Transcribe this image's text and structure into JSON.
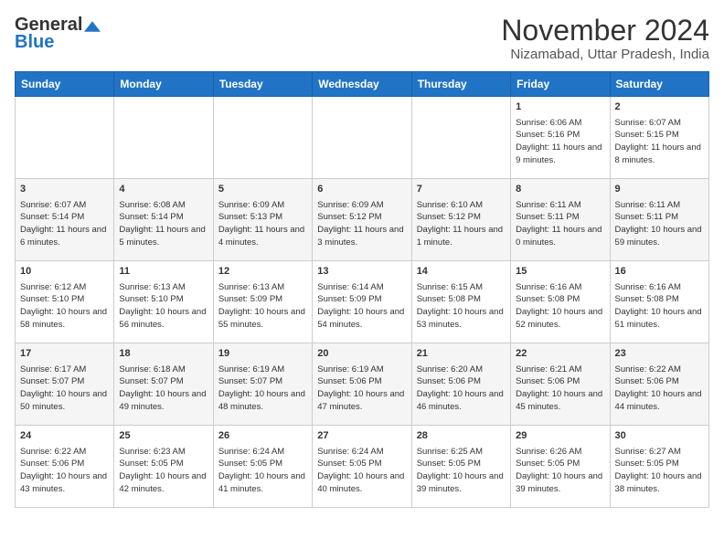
{
  "logo": {
    "general": "General",
    "blue": "Blue",
    "tagline": ""
  },
  "title": "November 2024",
  "subtitle": "Nizamabad, Uttar Pradesh, India",
  "weekdays": [
    "Sunday",
    "Monday",
    "Tuesday",
    "Wednesday",
    "Thursday",
    "Friday",
    "Saturday"
  ],
  "weeks": [
    [
      {
        "day": "",
        "info": ""
      },
      {
        "day": "",
        "info": ""
      },
      {
        "day": "",
        "info": ""
      },
      {
        "day": "",
        "info": ""
      },
      {
        "day": "",
        "info": ""
      },
      {
        "day": "1",
        "info": "Sunrise: 6:06 AM\nSunset: 5:16 PM\nDaylight: 11 hours and 9 minutes."
      },
      {
        "day": "2",
        "info": "Sunrise: 6:07 AM\nSunset: 5:15 PM\nDaylight: 11 hours and 8 minutes."
      }
    ],
    [
      {
        "day": "3",
        "info": "Sunrise: 6:07 AM\nSunset: 5:14 PM\nDaylight: 11 hours and 6 minutes."
      },
      {
        "day": "4",
        "info": "Sunrise: 6:08 AM\nSunset: 5:14 PM\nDaylight: 11 hours and 5 minutes."
      },
      {
        "day": "5",
        "info": "Sunrise: 6:09 AM\nSunset: 5:13 PM\nDaylight: 11 hours and 4 minutes."
      },
      {
        "day": "6",
        "info": "Sunrise: 6:09 AM\nSunset: 5:12 PM\nDaylight: 11 hours and 3 minutes."
      },
      {
        "day": "7",
        "info": "Sunrise: 6:10 AM\nSunset: 5:12 PM\nDaylight: 11 hours and 1 minute."
      },
      {
        "day": "8",
        "info": "Sunrise: 6:11 AM\nSunset: 5:11 PM\nDaylight: 11 hours and 0 minutes."
      },
      {
        "day": "9",
        "info": "Sunrise: 6:11 AM\nSunset: 5:11 PM\nDaylight: 10 hours and 59 minutes."
      }
    ],
    [
      {
        "day": "10",
        "info": "Sunrise: 6:12 AM\nSunset: 5:10 PM\nDaylight: 10 hours and 58 minutes."
      },
      {
        "day": "11",
        "info": "Sunrise: 6:13 AM\nSunset: 5:10 PM\nDaylight: 10 hours and 56 minutes."
      },
      {
        "day": "12",
        "info": "Sunrise: 6:13 AM\nSunset: 5:09 PM\nDaylight: 10 hours and 55 minutes."
      },
      {
        "day": "13",
        "info": "Sunrise: 6:14 AM\nSunset: 5:09 PM\nDaylight: 10 hours and 54 minutes."
      },
      {
        "day": "14",
        "info": "Sunrise: 6:15 AM\nSunset: 5:08 PM\nDaylight: 10 hours and 53 minutes."
      },
      {
        "day": "15",
        "info": "Sunrise: 6:16 AM\nSunset: 5:08 PM\nDaylight: 10 hours and 52 minutes."
      },
      {
        "day": "16",
        "info": "Sunrise: 6:16 AM\nSunset: 5:08 PM\nDaylight: 10 hours and 51 minutes."
      }
    ],
    [
      {
        "day": "17",
        "info": "Sunrise: 6:17 AM\nSunset: 5:07 PM\nDaylight: 10 hours and 50 minutes."
      },
      {
        "day": "18",
        "info": "Sunrise: 6:18 AM\nSunset: 5:07 PM\nDaylight: 10 hours and 49 minutes."
      },
      {
        "day": "19",
        "info": "Sunrise: 6:19 AM\nSunset: 5:07 PM\nDaylight: 10 hours and 48 minutes."
      },
      {
        "day": "20",
        "info": "Sunrise: 6:19 AM\nSunset: 5:06 PM\nDaylight: 10 hours and 47 minutes."
      },
      {
        "day": "21",
        "info": "Sunrise: 6:20 AM\nSunset: 5:06 PM\nDaylight: 10 hours and 46 minutes."
      },
      {
        "day": "22",
        "info": "Sunrise: 6:21 AM\nSunset: 5:06 PM\nDaylight: 10 hours and 45 minutes."
      },
      {
        "day": "23",
        "info": "Sunrise: 6:22 AM\nSunset: 5:06 PM\nDaylight: 10 hours and 44 minutes."
      }
    ],
    [
      {
        "day": "24",
        "info": "Sunrise: 6:22 AM\nSunset: 5:06 PM\nDaylight: 10 hours and 43 minutes."
      },
      {
        "day": "25",
        "info": "Sunrise: 6:23 AM\nSunset: 5:05 PM\nDaylight: 10 hours and 42 minutes."
      },
      {
        "day": "26",
        "info": "Sunrise: 6:24 AM\nSunset: 5:05 PM\nDaylight: 10 hours and 41 minutes."
      },
      {
        "day": "27",
        "info": "Sunrise: 6:24 AM\nSunset: 5:05 PM\nDaylight: 10 hours and 40 minutes."
      },
      {
        "day": "28",
        "info": "Sunrise: 6:25 AM\nSunset: 5:05 PM\nDaylight: 10 hours and 39 minutes."
      },
      {
        "day": "29",
        "info": "Sunrise: 6:26 AM\nSunset: 5:05 PM\nDaylight: 10 hours and 39 minutes."
      },
      {
        "day": "30",
        "info": "Sunrise: 6:27 AM\nSunset: 5:05 PM\nDaylight: 10 hours and 38 minutes."
      }
    ]
  ]
}
